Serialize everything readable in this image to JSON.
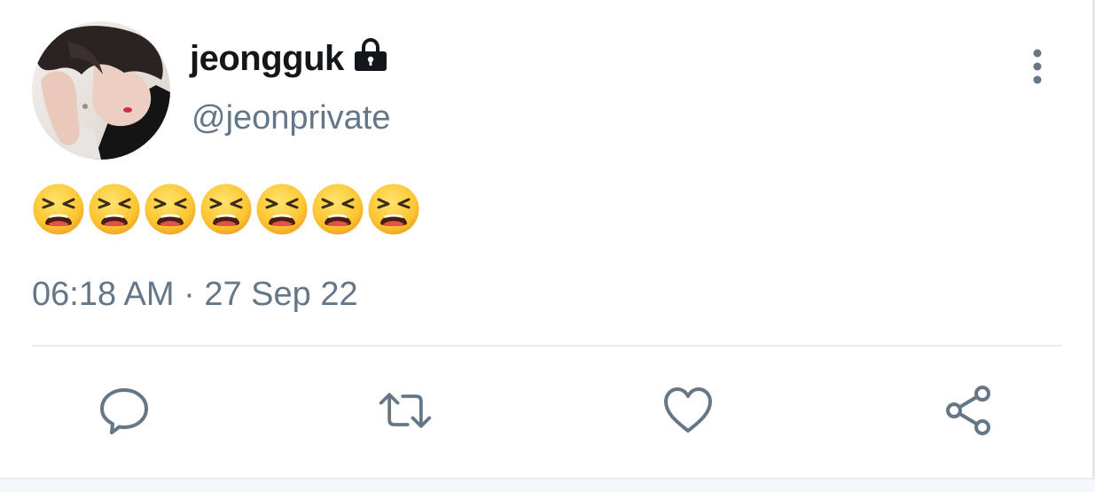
{
  "tweet": {
    "display_name": "jeongguk",
    "handle": "@jeonprivate",
    "protected": true,
    "content_emojis": [
      "tired-face",
      "tired-face",
      "tired-face",
      "tired-face",
      "tired-face",
      "tired-face",
      "tired-face"
    ],
    "timestamp": "06:18 AM · 27 Sep 22"
  },
  "icons": {
    "lock": "lock-icon",
    "more": "more-vertical-icon",
    "reply": "reply-icon",
    "retweet": "retweet-icon",
    "like": "heart-icon",
    "share": "share-icon"
  },
  "colors": {
    "text_primary": "#14171a",
    "text_secondary": "#657786",
    "icon_gray": "#657786",
    "divider": "#e6ecf0"
  }
}
